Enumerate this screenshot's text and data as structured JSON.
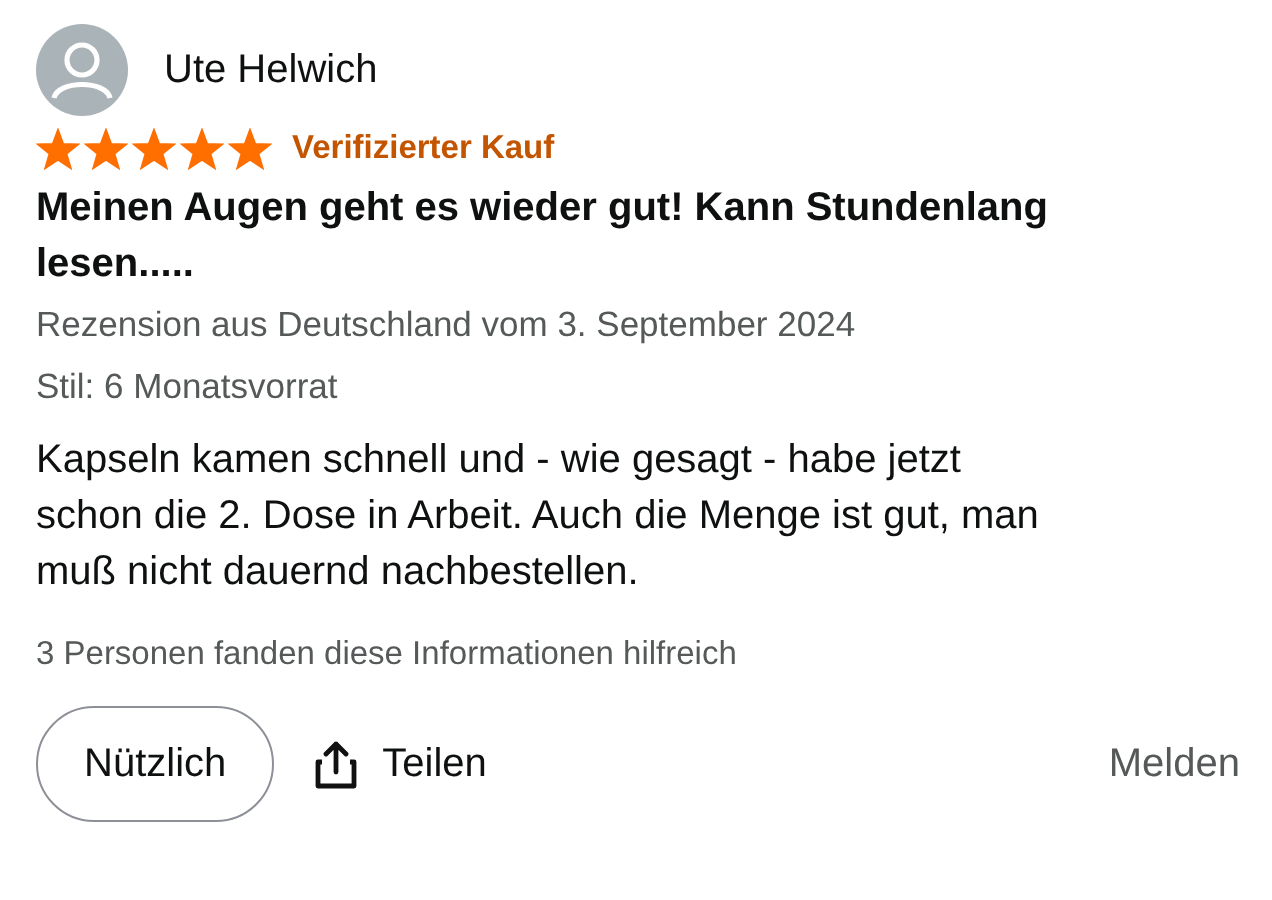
{
  "reviewer": {
    "name": "Ute Helwich"
  },
  "rating": {
    "stars": 5
  },
  "badge": "Verifizierter Kauf",
  "title": "Meinen Augen geht es wieder gut! Kann Stundenlang lesen.....",
  "meta": "Rezension aus Deutschland vom 3. September 2024",
  "variant": "Stil: 6 Monatsvorrat",
  "body": "Kapseln kamen schnell und - wie gesagt - habe jetzt schon die 2. Dose in Arbeit. Auch die Menge ist gut, man muß nicht dauernd nachbestellen.",
  "helpful_count": "3 Personen fanden diese Informationen hilfreich",
  "actions": {
    "helpful": "Nützlich",
    "share": "Teilen",
    "report": "Melden"
  }
}
